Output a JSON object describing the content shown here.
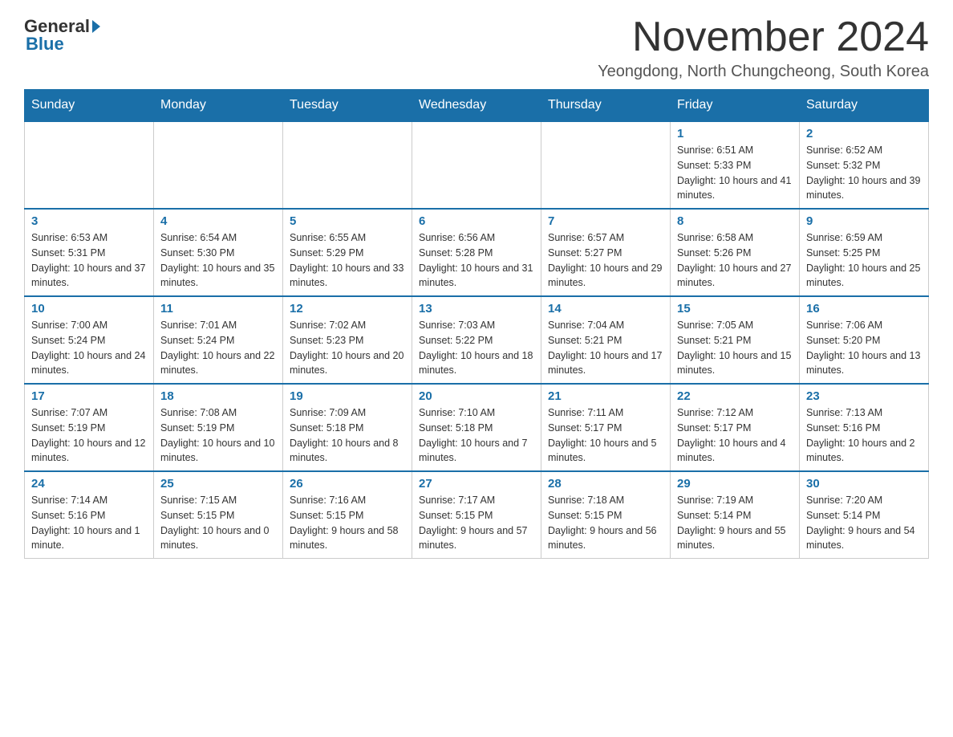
{
  "header": {
    "logo_general": "General",
    "logo_blue": "Blue",
    "month_title": "November 2024",
    "location": "Yeongdong, North Chungcheong, South Korea"
  },
  "days_of_week": [
    "Sunday",
    "Monday",
    "Tuesday",
    "Wednesday",
    "Thursday",
    "Friday",
    "Saturday"
  ],
  "weeks": [
    {
      "days": [
        {
          "date": "",
          "info": ""
        },
        {
          "date": "",
          "info": ""
        },
        {
          "date": "",
          "info": ""
        },
        {
          "date": "",
          "info": ""
        },
        {
          "date": "",
          "info": ""
        },
        {
          "date": "1",
          "info": "Sunrise: 6:51 AM\nSunset: 5:33 PM\nDaylight: 10 hours and 41 minutes."
        },
        {
          "date": "2",
          "info": "Sunrise: 6:52 AM\nSunset: 5:32 PM\nDaylight: 10 hours and 39 minutes."
        }
      ]
    },
    {
      "days": [
        {
          "date": "3",
          "info": "Sunrise: 6:53 AM\nSunset: 5:31 PM\nDaylight: 10 hours and 37 minutes."
        },
        {
          "date": "4",
          "info": "Sunrise: 6:54 AM\nSunset: 5:30 PM\nDaylight: 10 hours and 35 minutes."
        },
        {
          "date": "5",
          "info": "Sunrise: 6:55 AM\nSunset: 5:29 PM\nDaylight: 10 hours and 33 minutes."
        },
        {
          "date": "6",
          "info": "Sunrise: 6:56 AM\nSunset: 5:28 PM\nDaylight: 10 hours and 31 minutes."
        },
        {
          "date": "7",
          "info": "Sunrise: 6:57 AM\nSunset: 5:27 PM\nDaylight: 10 hours and 29 minutes."
        },
        {
          "date": "8",
          "info": "Sunrise: 6:58 AM\nSunset: 5:26 PM\nDaylight: 10 hours and 27 minutes."
        },
        {
          "date": "9",
          "info": "Sunrise: 6:59 AM\nSunset: 5:25 PM\nDaylight: 10 hours and 25 minutes."
        }
      ]
    },
    {
      "days": [
        {
          "date": "10",
          "info": "Sunrise: 7:00 AM\nSunset: 5:24 PM\nDaylight: 10 hours and 24 minutes."
        },
        {
          "date": "11",
          "info": "Sunrise: 7:01 AM\nSunset: 5:24 PM\nDaylight: 10 hours and 22 minutes."
        },
        {
          "date": "12",
          "info": "Sunrise: 7:02 AM\nSunset: 5:23 PM\nDaylight: 10 hours and 20 minutes."
        },
        {
          "date": "13",
          "info": "Sunrise: 7:03 AM\nSunset: 5:22 PM\nDaylight: 10 hours and 18 minutes."
        },
        {
          "date": "14",
          "info": "Sunrise: 7:04 AM\nSunset: 5:21 PM\nDaylight: 10 hours and 17 minutes."
        },
        {
          "date": "15",
          "info": "Sunrise: 7:05 AM\nSunset: 5:21 PM\nDaylight: 10 hours and 15 minutes."
        },
        {
          "date": "16",
          "info": "Sunrise: 7:06 AM\nSunset: 5:20 PM\nDaylight: 10 hours and 13 minutes."
        }
      ]
    },
    {
      "days": [
        {
          "date": "17",
          "info": "Sunrise: 7:07 AM\nSunset: 5:19 PM\nDaylight: 10 hours and 12 minutes."
        },
        {
          "date": "18",
          "info": "Sunrise: 7:08 AM\nSunset: 5:19 PM\nDaylight: 10 hours and 10 minutes."
        },
        {
          "date": "19",
          "info": "Sunrise: 7:09 AM\nSunset: 5:18 PM\nDaylight: 10 hours and 8 minutes."
        },
        {
          "date": "20",
          "info": "Sunrise: 7:10 AM\nSunset: 5:18 PM\nDaylight: 10 hours and 7 minutes."
        },
        {
          "date": "21",
          "info": "Sunrise: 7:11 AM\nSunset: 5:17 PM\nDaylight: 10 hours and 5 minutes."
        },
        {
          "date": "22",
          "info": "Sunrise: 7:12 AM\nSunset: 5:17 PM\nDaylight: 10 hours and 4 minutes."
        },
        {
          "date": "23",
          "info": "Sunrise: 7:13 AM\nSunset: 5:16 PM\nDaylight: 10 hours and 2 minutes."
        }
      ]
    },
    {
      "days": [
        {
          "date": "24",
          "info": "Sunrise: 7:14 AM\nSunset: 5:16 PM\nDaylight: 10 hours and 1 minute."
        },
        {
          "date": "25",
          "info": "Sunrise: 7:15 AM\nSunset: 5:15 PM\nDaylight: 10 hours and 0 minutes."
        },
        {
          "date": "26",
          "info": "Sunrise: 7:16 AM\nSunset: 5:15 PM\nDaylight: 9 hours and 58 minutes."
        },
        {
          "date": "27",
          "info": "Sunrise: 7:17 AM\nSunset: 5:15 PM\nDaylight: 9 hours and 57 minutes."
        },
        {
          "date": "28",
          "info": "Sunrise: 7:18 AM\nSunset: 5:15 PM\nDaylight: 9 hours and 56 minutes."
        },
        {
          "date": "29",
          "info": "Sunrise: 7:19 AM\nSunset: 5:14 PM\nDaylight: 9 hours and 55 minutes."
        },
        {
          "date": "30",
          "info": "Sunrise: 7:20 AM\nSunset: 5:14 PM\nDaylight: 9 hours and 54 minutes."
        }
      ]
    }
  ]
}
